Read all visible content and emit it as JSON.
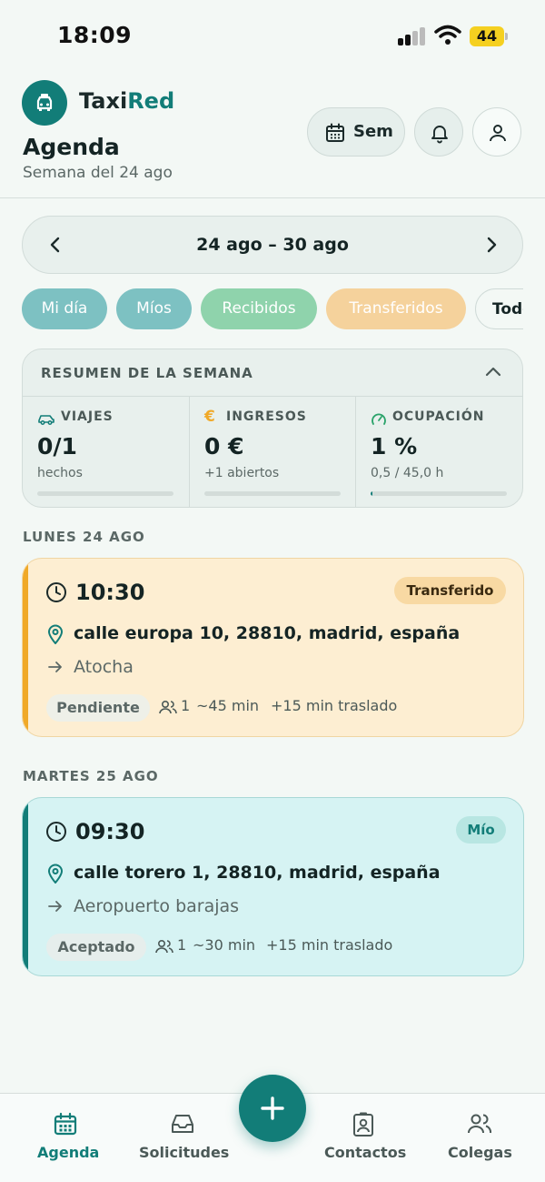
{
  "status_bar": {
    "time": "18:09",
    "battery": "44"
  },
  "header": {
    "brand_part1": "Taxi",
    "brand_part2": "Red",
    "title": "Agenda",
    "subtitle": "Semana del 24 ago",
    "week_button_label": "Sem",
    "bell_icon": "bell-icon",
    "profile_icon": "user-icon"
  },
  "week_nav": {
    "range": "24 ago – 30 ago"
  },
  "filters": [
    {
      "label": "Mi día",
      "bg": "#7dc1c2",
      "color": "#ffffff"
    },
    {
      "label": "Míos",
      "bg": "#7dc1c2",
      "color": "#ffffff"
    },
    {
      "label": "Recibidos",
      "bg": "#8fd3ac",
      "color": "#ffffff"
    },
    {
      "label": "Transferidos",
      "bg": "#f5d29c",
      "color": "#ffffff"
    },
    {
      "label": "Todos",
      "bg": "#f3f8f5",
      "color": "#142424"
    }
  ],
  "summary": {
    "title": "RESUMEN DE LA SEMANA",
    "stats": [
      {
        "label": "VIAJES",
        "value": "0/1",
        "sub": "hechos",
        "progress": 0,
        "icon": "car-icon"
      },
      {
        "label": "INGRESOS",
        "value": "0 €",
        "sub": "+1 abiertos",
        "progress": 0,
        "icon": "euro-icon"
      },
      {
        "label": "OCUPACIÓN",
        "value": "1 %",
        "sub": "0,5 / 45,0 h",
        "progress": 0.011,
        "icon": "gauge-icon"
      }
    ]
  },
  "days": [
    {
      "heading": "LUNES 24 AGO",
      "ride": {
        "time": "10:30",
        "badge": "Transferido",
        "address": "calle europa 10, 28810, madrid, españa",
        "destination": "Atocha",
        "state": "Pendiente",
        "passengers": "1",
        "duration": "~45 min",
        "transfer": "+15 min traslado"
      }
    },
    {
      "heading": "MARTES 25 AGO",
      "ride": {
        "time": "09:30",
        "badge": "Mío",
        "address": "calle torero 1, 28810, madrid, españa",
        "destination": "Aeropuerto barajas",
        "state": "Aceptado",
        "passengers": "1",
        "duration": "~30 min",
        "transfer": "+15 min traslado"
      }
    }
  ],
  "bottom_nav": [
    {
      "label": "Agenda",
      "icon": "calendar-icon",
      "active": true
    },
    {
      "label": "Solicitudes",
      "icon": "inbox-icon",
      "active": false
    },
    {
      "label": "Contactos",
      "icon": "contact-card-icon",
      "active": false
    },
    {
      "label": "Colegas",
      "icon": "users-icon",
      "active": false
    }
  ],
  "fab_icon": "plus-icon",
  "colors": {
    "primary": "#127d78",
    "transfer_accent": "#f0a928",
    "mine_accent": "#127d78"
  }
}
